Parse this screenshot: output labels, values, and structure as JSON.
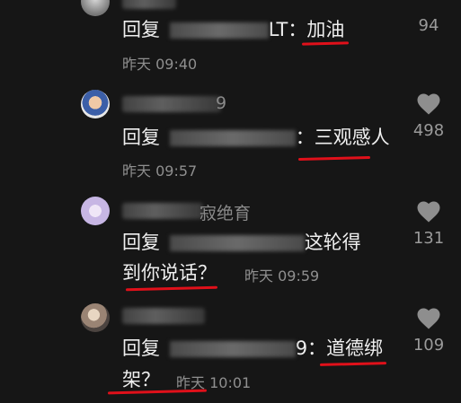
{
  "comments": [
    {
      "username_suffix": "",
      "reply_prefix": "回复",
      "reply_target_visible": "LT：",
      "highlight_text": "加油",
      "time": "昨天 09:40",
      "like_count": "94"
    },
    {
      "username_suffix": "9",
      "reply_prefix": "回复",
      "reply_target_visible": "：",
      "highlight_text": "三观感人",
      "time": "昨天 09:57",
      "like_count": "498"
    },
    {
      "username_suffix": "寂绝育",
      "reply_prefix": "回复",
      "reply_target_visible": "这轮得",
      "highlight_text": "到你说话？",
      "time": "昨天 09:59",
      "like_count": "131"
    },
    {
      "username_suffix": "",
      "reply_prefix": "回复",
      "reply_target_visible": "9：",
      "highlight_text_line1": "道德绑",
      "highlight_text_line2": "架？",
      "time": "昨天 10:01",
      "like_count": "109"
    }
  ],
  "colors": {
    "background": "#161616",
    "underline": "#e0101a",
    "muted_text": "#8f8f8f"
  },
  "icons": {
    "like": "heart-icon"
  }
}
